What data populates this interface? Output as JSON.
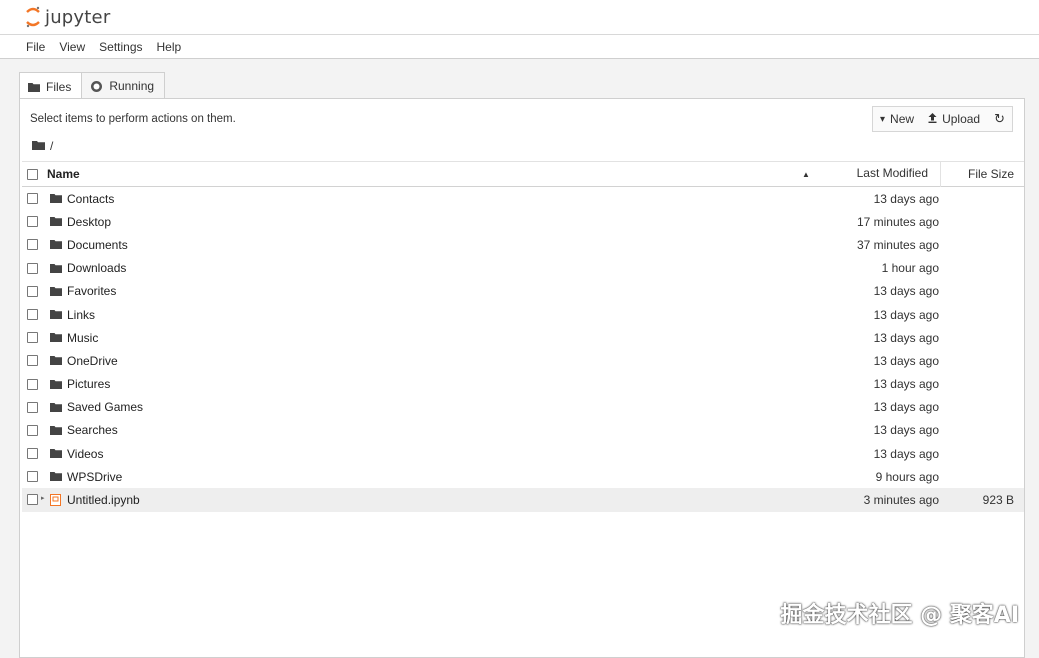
{
  "app": {
    "logo_text": "jupyter"
  },
  "menu": [
    "File",
    "View",
    "Settings",
    "Help"
  ],
  "tabs": [
    {
      "label": "Files",
      "active": true
    },
    {
      "label": "Running",
      "active": false
    }
  ],
  "panel": {
    "hint": "Select items to perform actions on them.",
    "toolbar": {
      "new_label": "New",
      "upload_label": "Upload"
    },
    "breadcrumb": "/"
  },
  "list": {
    "headers": {
      "name": "Name",
      "modified": "Last Modified",
      "size": "File Size"
    },
    "rows": [
      {
        "name": "Contacts",
        "modified": "13 days ago",
        "size": "",
        "type": "folder"
      },
      {
        "name": "Desktop",
        "modified": "17 minutes ago",
        "size": "",
        "type": "folder"
      },
      {
        "name": "Documents",
        "modified": "37 minutes ago",
        "size": "",
        "type": "folder"
      },
      {
        "name": "Downloads",
        "modified": "1 hour ago",
        "size": "",
        "type": "folder"
      },
      {
        "name": "Favorites",
        "modified": "13 days ago",
        "size": "",
        "type": "folder"
      },
      {
        "name": "Links",
        "modified": "13 days ago",
        "size": "",
        "type": "folder"
      },
      {
        "name": "Music",
        "modified": "13 days ago",
        "size": "",
        "type": "folder"
      },
      {
        "name": "OneDrive",
        "modified": "13 days ago",
        "size": "",
        "type": "folder"
      },
      {
        "name": "Pictures",
        "modified": "13 days ago",
        "size": "",
        "type": "folder"
      },
      {
        "name": "Saved Games",
        "modified": "13 days ago",
        "size": "",
        "type": "folder"
      },
      {
        "name": "Searches",
        "modified": "13 days ago",
        "size": "",
        "type": "folder"
      },
      {
        "name": "Videos",
        "modified": "13 days ago",
        "size": "",
        "type": "folder"
      },
      {
        "name": "WPSDrive",
        "modified": "9 hours ago",
        "size": "",
        "type": "folder"
      },
      {
        "name": "Untitled.ipynb",
        "modified": "3 minutes ago",
        "size": "923 B",
        "type": "notebook"
      }
    ]
  },
  "watermark": "掘金技术社区 @ 聚客AI",
  "colors": {
    "logo_orange": "#f37626",
    "folder": "#444444",
    "notebook": "#f37626"
  }
}
